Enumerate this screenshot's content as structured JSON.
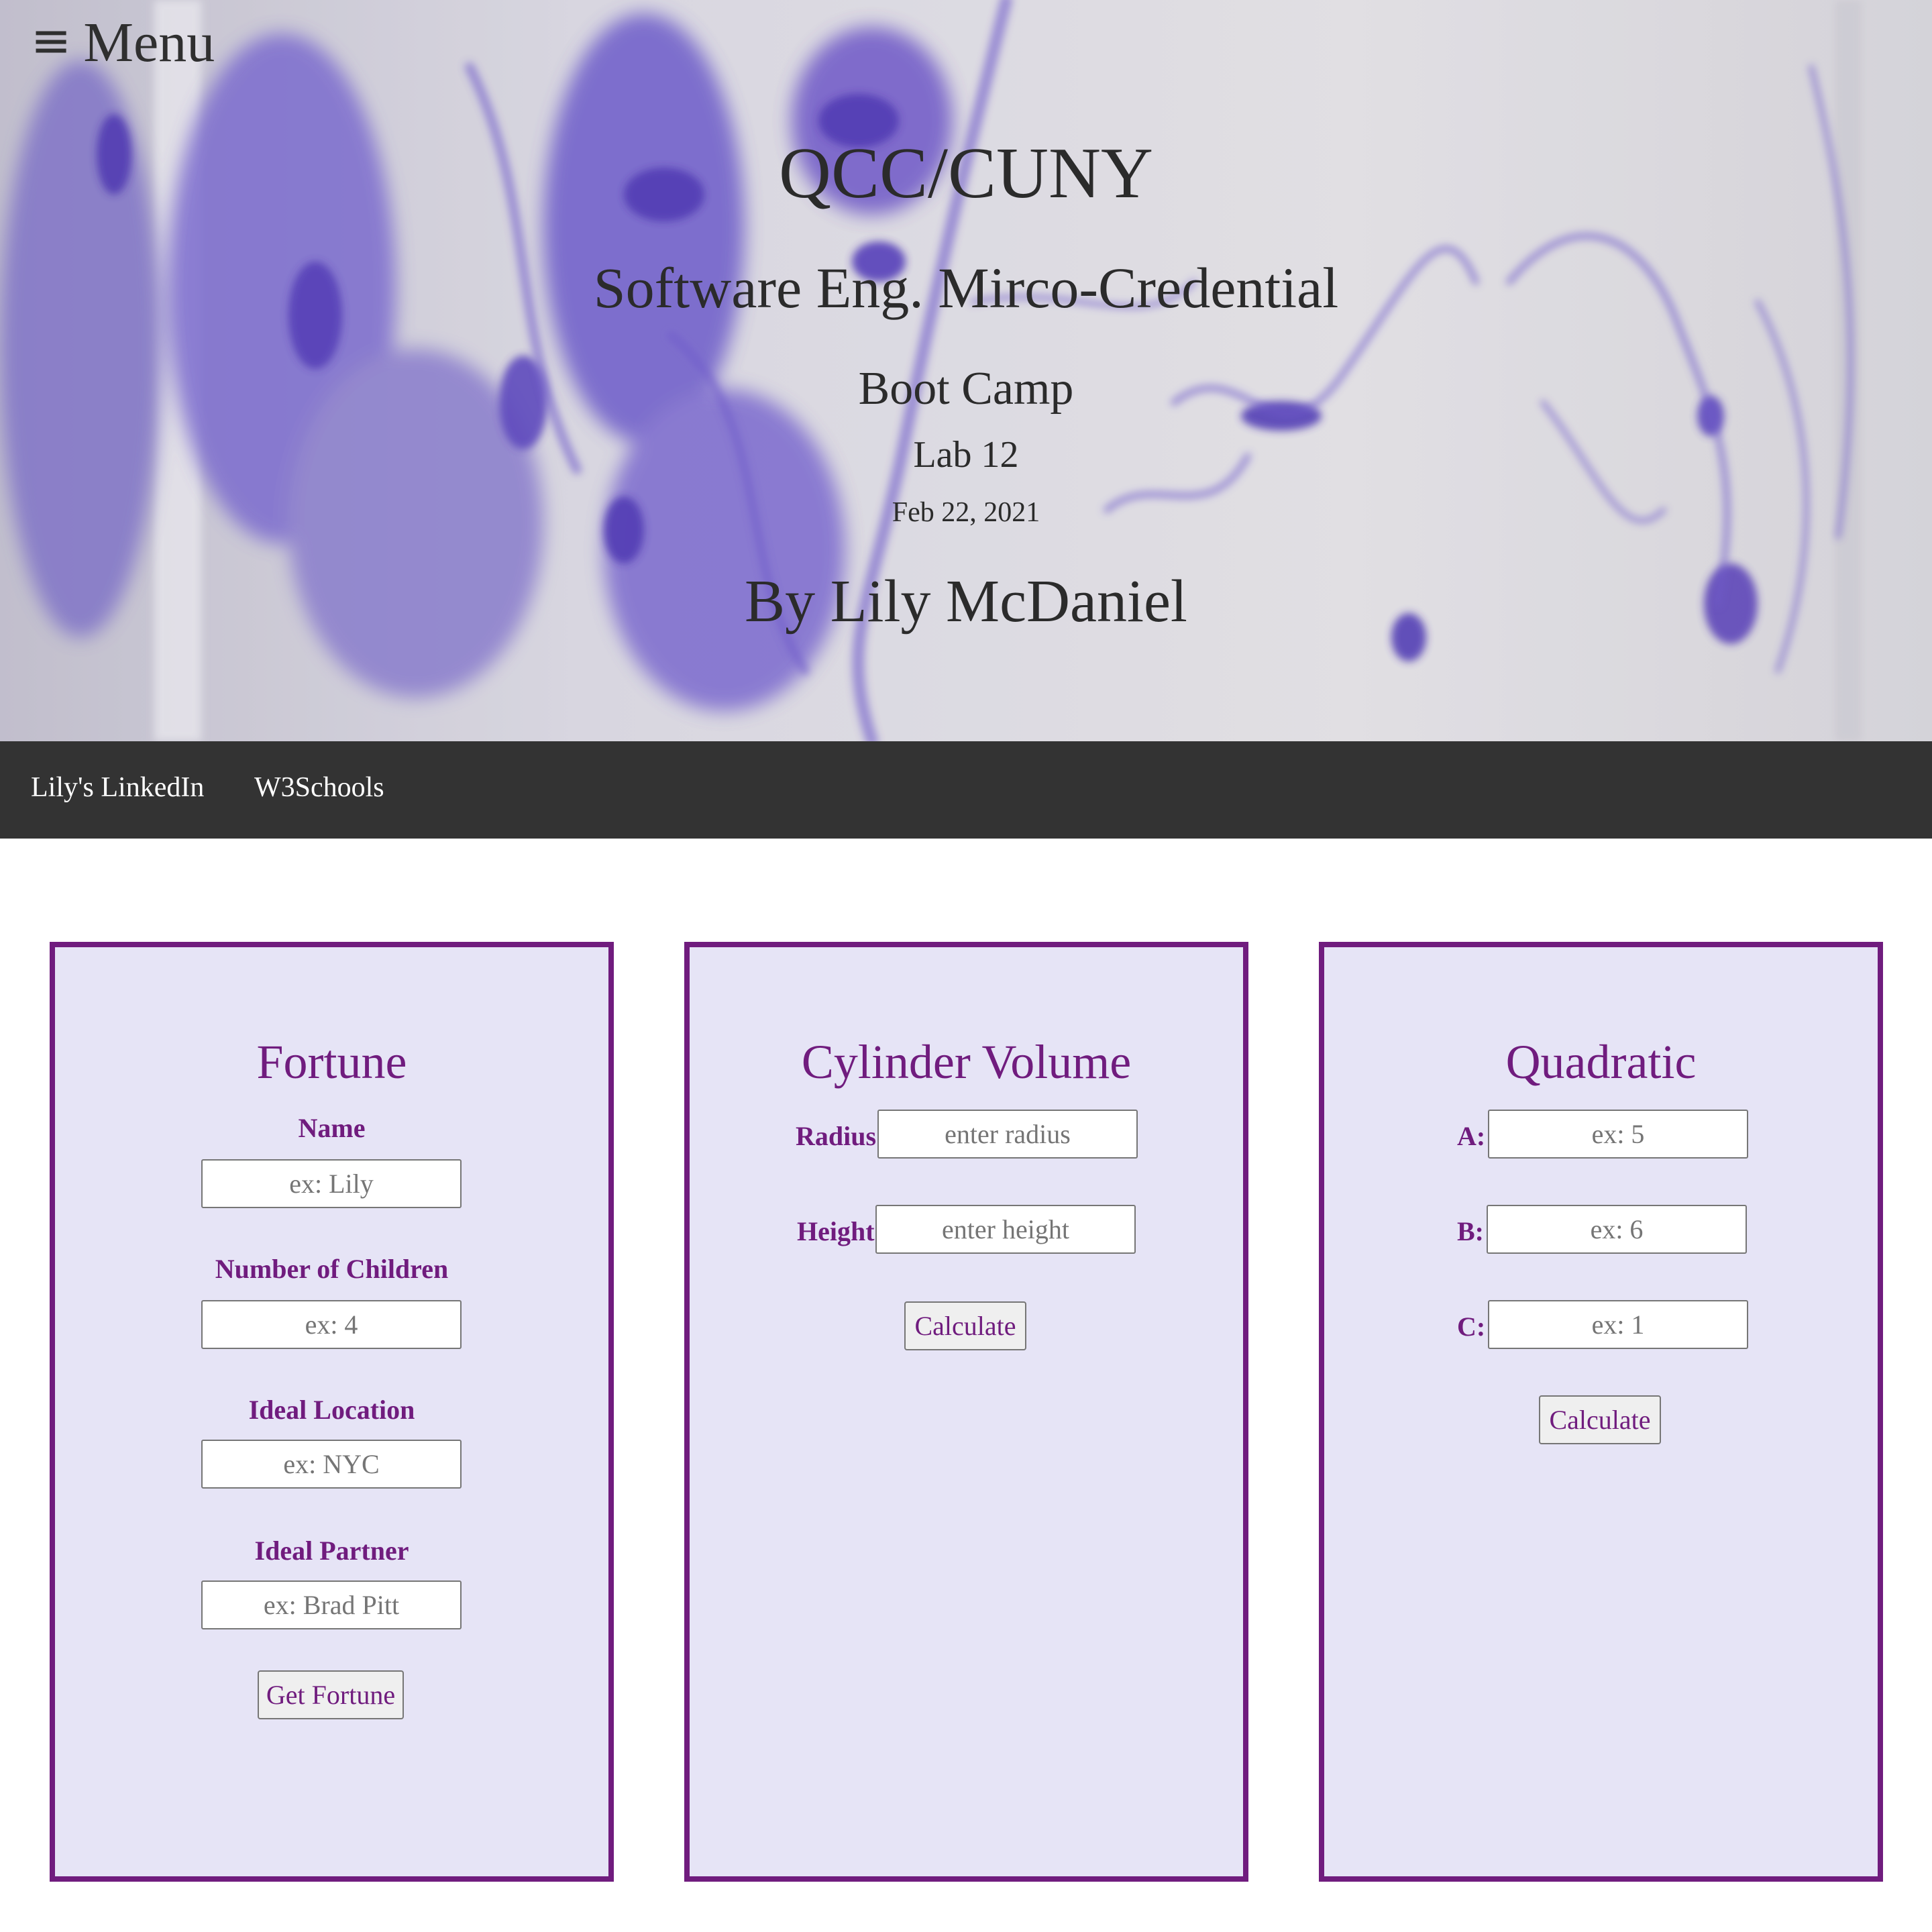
{
  "header": {
    "menu_icon": "≡",
    "menu_label": "Menu",
    "title": "QCC/CUNY",
    "subtitle": "Software Eng. Mirco-Credential",
    "program": "Boot Camp",
    "lab": "Lab 12",
    "date": "Feb 22, 2021",
    "author": "By Lily McDaniel"
  },
  "nav": {
    "links": [
      {
        "label": "Lily's LinkedIn"
      },
      {
        "label": "W3Schools"
      }
    ]
  },
  "theme": {
    "accent": "#701c7e",
    "card_bg": "#e6e4f6",
    "nav_bg": "#333333"
  },
  "fortune": {
    "title": "Fortune",
    "fields": [
      {
        "label": "Name",
        "placeholder": "ex: Lily"
      },
      {
        "label": "Number of Children",
        "placeholder": "ex: 4"
      },
      {
        "label": "Ideal Location",
        "placeholder": "ex: NYC"
      },
      {
        "label": "Ideal Partner",
        "placeholder": "ex: Brad Pitt"
      }
    ],
    "button": "Get Fortune"
  },
  "cylinder": {
    "title": "Cylinder Volume",
    "fields": [
      {
        "label": "Radius",
        "placeholder": "enter radius"
      },
      {
        "label": "Height",
        "placeholder": "enter height"
      }
    ],
    "button": "Calculate"
  },
  "quadratic": {
    "title": "Quadratic",
    "fields": [
      {
        "label": "A:",
        "placeholder": "ex: 5"
      },
      {
        "label": "B:",
        "placeholder": "ex: 6"
      },
      {
        "label": "C:",
        "placeholder": "ex: 1"
      }
    ],
    "button": "Calculate"
  }
}
